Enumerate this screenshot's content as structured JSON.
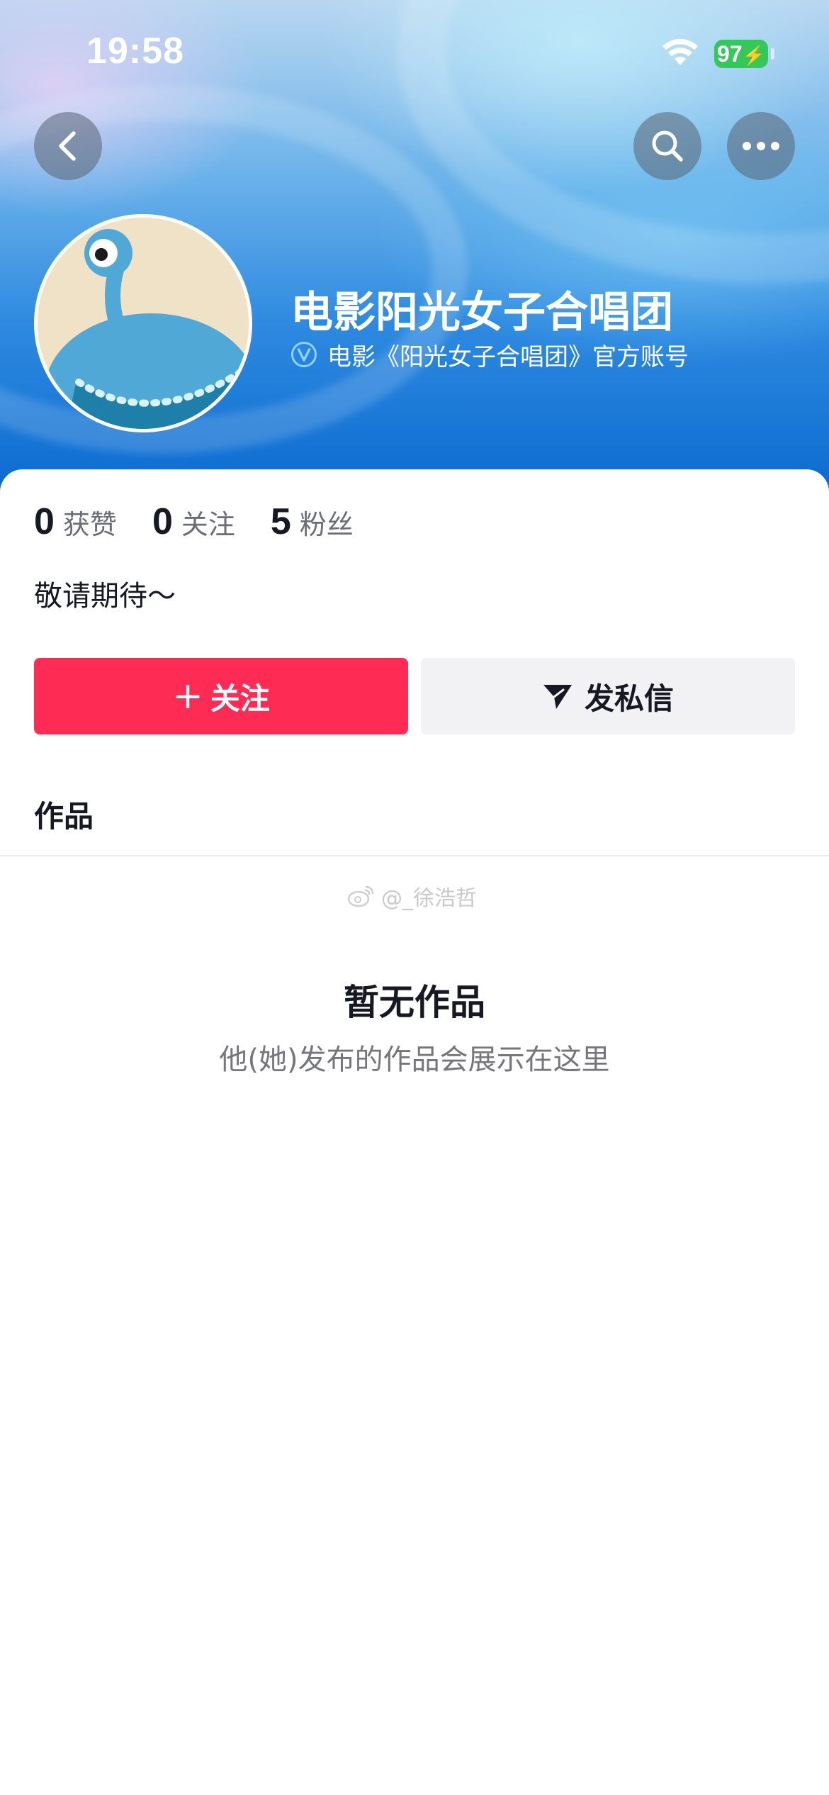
{
  "status_bar": {
    "time": "19:58",
    "battery": "97"
  },
  "profile": {
    "name": "电影阳光女子合唱团",
    "verification": "电影《阳光女子合唱团》官方账号",
    "bio": "敬请期待～"
  },
  "stats": [
    {
      "value": "0",
      "label": "获赞"
    },
    {
      "value": "0",
      "label": "关注"
    },
    {
      "value": "5",
      "label": "粉丝"
    }
  ],
  "actions": {
    "follow_plus": "+",
    "follow_label": "关注",
    "message_label": "发私信"
  },
  "tabs": {
    "works": "作品"
  },
  "watermark": "@_徐浩哲",
  "empty_state": {
    "title": "暂无作品",
    "subtitle": "他(她)发布的作品会展示在这里"
  },
  "colors": {
    "accent": "#fe2c55",
    "verify_blue": "#3fa9f5",
    "battery_green": "#34c759"
  }
}
